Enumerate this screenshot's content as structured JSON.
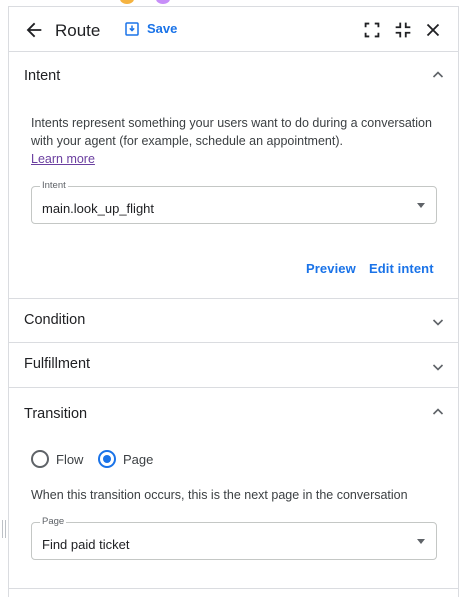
{
  "header": {
    "title": "Route",
    "save_label": "Save"
  },
  "intent_section": {
    "title": "Intent",
    "description": "Intents represent something your users want to do during a conversation with your agent (for example, schedule an appointment).",
    "learn_more": "Learn more",
    "field_label": "Intent",
    "field_value": "main.look_up_flight",
    "preview_label": "Preview",
    "edit_label": "Edit intent"
  },
  "condition_section": {
    "title": "Condition"
  },
  "fulfillment_section": {
    "title": "Fulfillment"
  },
  "transition_section": {
    "title": "Transition",
    "options": [
      "Flow",
      "Page"
    ],
    "selected": "Page",
    "description": "When this transition occurs, this is the next page in the conversation",
    "field_label": "Page",
    "field_value": "Find paid ticket"
  },
  "colors": {
    "accent": "#1a73e8",
    "link_visited": "#6b3fa0",
    "divider": "#dadce0"
  }
}
